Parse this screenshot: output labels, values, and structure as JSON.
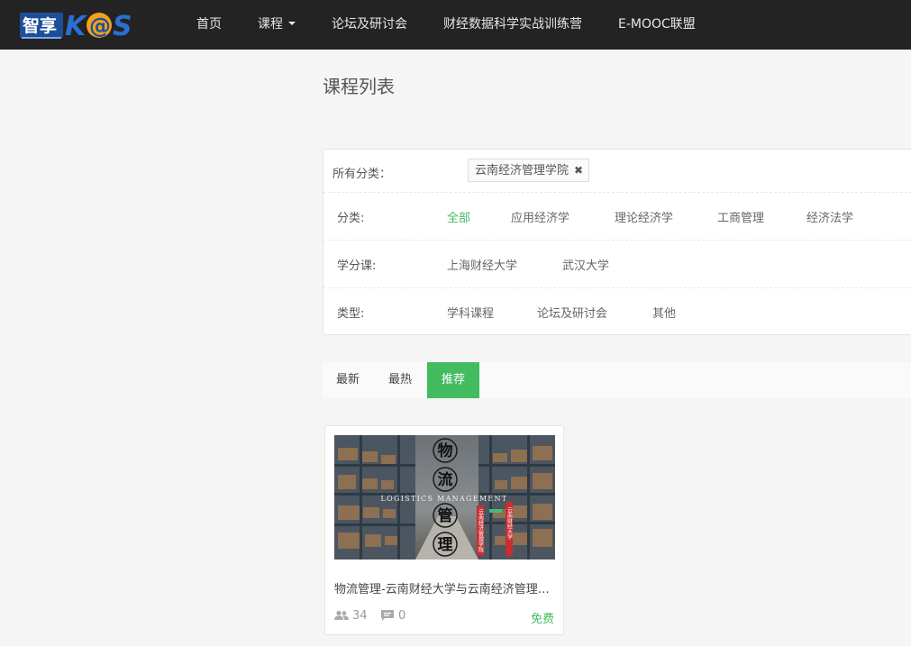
{
  "nav": {
    "logo_text": "智享K@S",
    "items": [
      {
        "label": "首页"
      },
      {
        "label": "课程"
      },
      {
        "label": "论坛及研讨会"
      },
      {
        "label": "财经数据科学实战训练营"
      },
      {
        "label": "E-MOOC联盟"
      }
    ]
  },
  "page_title": "课程列表",
  "filters": {
    "all_label": "所有分类：",
    "selected_tag": "云南经济管理学院",
    "category": {
      "label": "分类:",
      "options": [
        "全部",
        "应用经济学",
        "理论经济学",
        "工商管理",
        "经济法学"
      ],
      "active": "全部"
    },
    "school": {
      "label": "学分课:",
      "options": [
        "上海财经大学",
        "武汉大学"
      ]
    },
    "type": {
      "label": "类型:",
      "options": [
        "学科课程",
        "论坛及研讨会",
        "其他"
      ]
    }
  },
  "sort_tabs": [
    {
      "label": "最新"
    },
    {
      "label": "最热"
    },
    {
      "label": "推荐"
    }
  ],
  "sort_active": "推荐",
  "courses": [
    {
      "title": "物流管理-云南财经大学与云南经济管理学院",
      "thumb_chars": [
        "物",
        "流",
        "管",
        "理"
      ],
      "thumb_caption": "LOGISTICS MANAGEMENT",
      "thumb_banner_left": "云南经济管理学院",
      "thumb_banner_right": "云南财经大学",
      "students": "34",
      "comments": "0",
      "price": "免费"
    }
  ],
  "colors": {
    "accent": "#43bc60",
    "nav_bg": "#232323"
  }
}
